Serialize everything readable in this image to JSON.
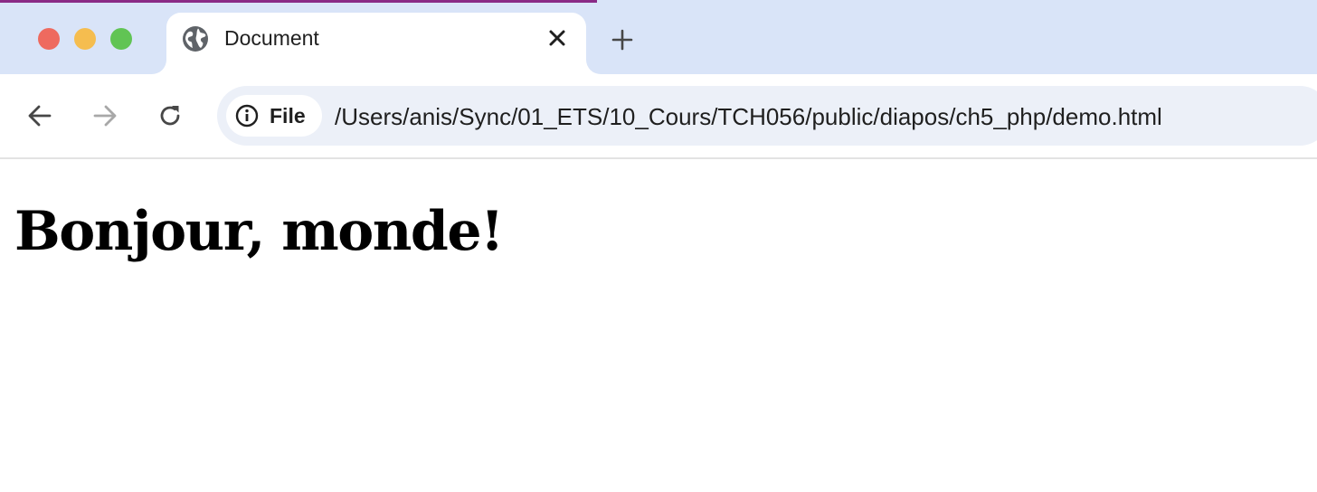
{
  "colors": {
    "tabstrip": "#d9e4f8",
    "traffic_red": "#ee6a5f",
    "traffic_yellow": "#f5bd4f",
    "traffic_green": "#61c454",
    "omnibox_bg": "#ecf0f8",
    "icon_dark": "#474747",
    "icon_disabled": "#a8a8a8"
  },
  "window_controls": {
    "close_icon": "circle",
    "minimize_icon": "circle",
    "zoom_icon": "circle"
  },
  "tab": {
    "title": "Document",
    "favicon": "globe-icon",
    "close_icon": "close-icon"
  },
  "new_tab_icon": "plus-icon",
  "toolbar": {
    "back_icon": "arrow-left-icon",
    "forward_icon": "arrow-right-icon",
    "reload_icon": "reload-icon"
  },
  "omnibox": {
    "chip_icon": "info-icon",
    "chip_label": "File",
    "url": "/Users/anis/Sync/01_ETS/10_Cours/TCH056/public/diapos/ch5_php/demo.html"
  },
  "page": {
    "heading": "Bonjour, monde!"
  }
}
